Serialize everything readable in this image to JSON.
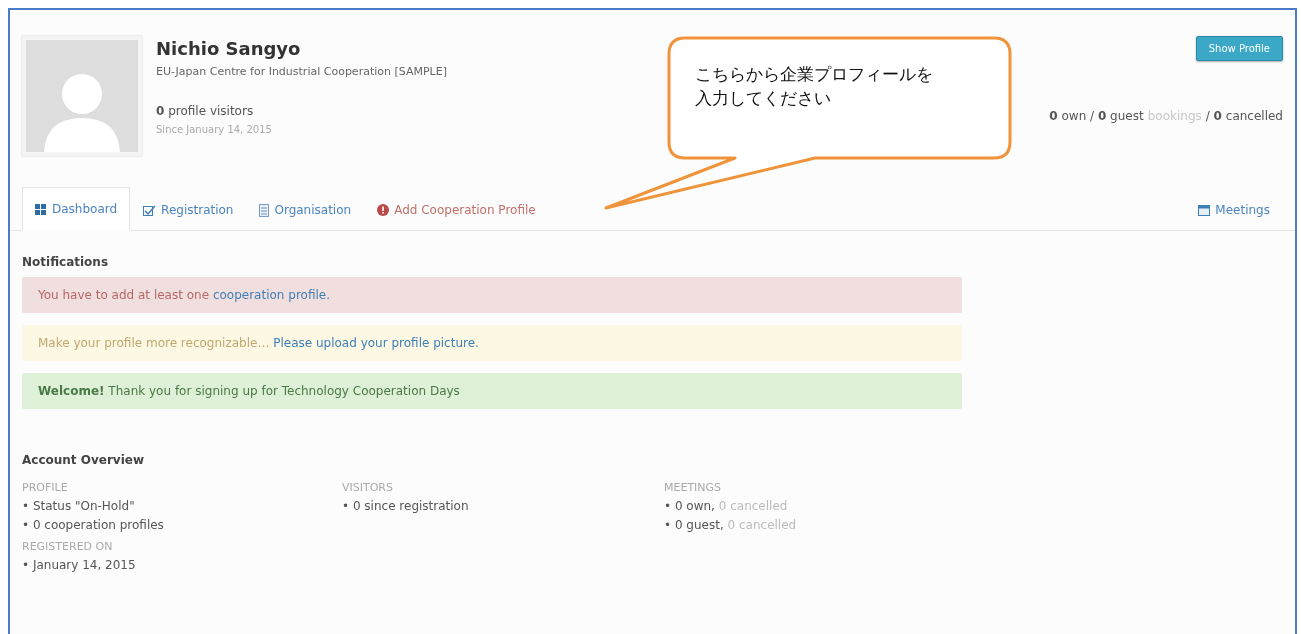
{
  "profile": {
    "name": "Nichio Sangyo",
    "organisation": "EU-Japan Centre for Industrial Cooperation [SAMPLE]",
    "visitors": "**0** profile visitors",
    "since": "Since January 14, 2015"
  },
  "show_profile_button": "Show Profile",
  "booking_stats": [
    {
      "text": "**0** own / **0** guest",
      "muted": false
    },
    {
      "text": "bookings",
      "muted": true
    },
    {
      "text": "/ **0** cancelled",
      "muted": false
    }
  ],
  "tabs": [
    {
      "label": "Dashboard",
      "selected": true,
      "alert": false
    },
    {
      "label": "Registration",
      "selected": false,
      "alert": false
    },
    {
      "label": "Organisation",
      "selected": false,
      "alert": false
    },
    {
      "label": "Add Cooperation Profile",
      "selected": false,
      "alert": true
    }
  ],
  "meetings_tab": {
    "label": "Meetings",
    "selected": false
  },
  "callout": {
    "text": "こちらから企業プロフィールを入力してください"
  },
  "notifications_title": "Notifications",
  "notifications": [
    {
      "kind": "danger",
      "text": "You have to add at least one",
      "link": "cooperation profile."
    },
    {
      "kind": "warning",
      "text": "Make your profile more recognizable…",
      "link": "Please upload your profile picture."
    },
    {
      "kind": "success",
      "text": "**Welcome!** Thank you for signing up for Technology Cooperation Days"
    }
  ],
  "account_overview": {
    "title": "Account Overview",
    "columns": [
      {
        "sections": [
          {
            "heading": "PROFILE",
            "lines": [
              {
                "text": "• Status \"On-Hold\""
              },
              {
                "text": "• 0 cooperation profiles"
              }
            ]
          },
          {
            "heading": "REGISTERED ON",
            "lines": [
              {
                "text": "• January 14, 2015"
              }
            ]
          }
        ]
      },
      {
        "sections": [
          {
            "heading": "VISITORS",
            "lines": [
              {
                "text": "• 0 since registration"
              }
            ]
          }
        ]
      },
      {
        "sections": [
          {
            "heading": "MEETINGS",
            "lines": [
              {
                "text": "• 0 own,",
                "muted": "0 cancelled"
              },
              {
                "text": "• 0 guest,",
                "muted": "0 cancelled"
              }
            ]
          }
        ]
      }
    ]
  }
}
